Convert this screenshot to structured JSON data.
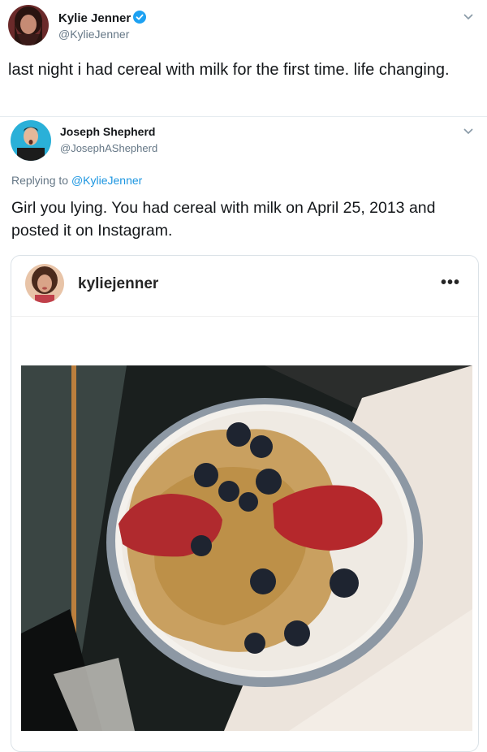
{
  "tweet": {
    "author": {
      "name": "Kylie Jenner",
      "handle": "@KylieJenner",
      "verified": true
    },
    "text": "last night i had cereal with milk for the first time. life changing."
  },
  "reply": {
    "author": {
      "name": "Joseph Shepherd",
      "handle": "@JosephAShepherd"
    },
    "replying_prefix": "Replying to ",
    "replying_to": "@KylieJenner",
    "text": "Girl you lying. You had cereal with milk on April 25, 2013 and posted it on Instagram."
  },
  "instagram_embed": {
    "username": "kyliejenner",
    "more_label": "•••"
  },
  "colors": {
    "link": "#1b95e0",
    "verified": "#1da1f2",
    "secondary_text": "#657786"
  },
  "icons": {
    "verified": "verified-badge-icon",
    "caret": "chevron-down-icon",
    "more": "more-options-icon"
  }
}
